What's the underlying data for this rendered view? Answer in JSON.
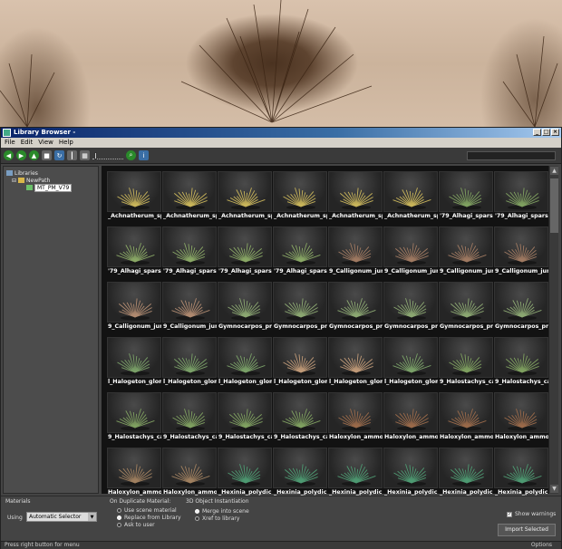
{
  "window": {
    "title": "Library Browser -"
  },
  "menu": [
    "File",
    "Edit",
    "View",
    "Help"
  ],
  "toolbar": {
    "icons": [
      "back-icon",
      "forward-icon",
      "up-icon",
      "stop-icon",
      "refresh-icon",
      "properties-icon",
      "view-mode-icon",
      "zoom-slider",
      "zoom-icon",
      "info-icon"
    ]
  },
  "tree": {
    "root": "Libraries",
    "child": "NewPath",
    "selected": "MT_PM_V79"
  },
  "grid": {
    "items": [
      "_Achnatherum_sple",
      "_Achnatherum_sple",
      "_Achnatherum_sple",
      "_Achnatherum_sple",
      "_Achnatherum_sple",
      "_Achnatherum_sple",
      "'79_Alhagi_sparsifo",
      "'79_Alhagi_sparsifo",
      "'79_Alhagi_sparsifo",
      "'79_Alhagi_sparsifo",
      "'79_Alhagi_sparsifo",
      "'79_Alhagi_sparsifo",
      "9_Calligonum_junc",
      "9_Calligonum_junc",
      "9_Calligonum_junc",
      "9_Calligonum_junc",
      "9_Calligonum_junc",
      "9_Calligonum_junc",
      "Gymnocarpos_prze",
      "Gymnocarpos_prze",
      "Gymnocarpos_prze",
      "Gymnocarpos_prze",
      "Gymnocarpos_prze",
      "Gymnocarpos_prze",
      "l_Halogeton_glome",
      "l_Halogeton_glome",
      "l_Halogeton_glome",
      "l_Halogeton_glome",
      "l_Halogeton_glome",
      "l_Halogeton_glome",
      "9_Halostachys_cas",
      "9_Halostachys_cas",
      "9_Halostachys_cas",
      "9_Halostachys_cas",
      "9_Halostachys_cas",
      "9_Halostachys_cas",
      "Haloxylon_ammode",
      "Haloxylon_ammode",
      "Haloxylon_ammode",
      "Haloxylon_ammode",
      "Haloxylon_ammode",
      "Haloxylon_ammode",
      "_Hexinia_polydiche",
      "_Hexinia_polydiche",
      "_Hexinia_polydiche",
      "_Hexinia_polydiche",
      "_Hexinia_polydiche",
      "_Hexinia_polydiche"
    ],
    "colors": [
      "#c8b45a",
      "#c8b45a",
      "#c8b45a",
      "#c8b45a",
      "#c8b45a",
      "#c8b45a",
      "#7fa060",
      "#7fa060",
      "#8aa866",
      "#8aa866",
      "#8aa866",
      "#8aa866",
      "#a07a62",
      "#a07a62",
      "#a07a62",
      "#a07a62",
      "#b08a70",
      "#b08a70",
      "#8ca872",
      "#8ca872",
      "#8ca872",
      "#8ca872",
      "#8ca872",
      "#8ca872",
      "#7aa068",
      "#7aa068",
      "#7aa068",
      "#c09a78",
      "#c09a78",
      "#7aa068",
      "#7fa060",
      "#7fa060",
      "#7fa060",
      "#7fa060",
      "#7fa060",
      "#7fa060",
      "#9a6a4a",
      "#9a6a4a",
      "#9a6a4a",
      "#9a6a4a",
      "#a08060",
      "#a08060",
      "#4e9a72",
      "#4e9a72",
      "#4e9a72",
      "#4e9a72",
      "#4e9a72",
      "#4e9a72"
    ]
  },
  "options": {
    "materials_label": "Materials",
    "using_label": "Using",
    "using_value": "Automatic Selector",
    "duplicate_label": "On Duplicate Material:",
    "duplicate_options": [
      "Use scene material",
      "Replace from Library",
      "Ask to user"
    ],
    "duplicate_selected": 1,
    "object_label": "3D Object Instantiation",
    "object_options": [
      "Merge into scene",
      "Xref to library"
    ],
    "object_selected": 0,
    "show_warnings": "Show warnings",
    "import_button": "Import Selected"
  },
  "status": {
    "left": "Press right button for menu",
    "right": "Options"
  }
}
